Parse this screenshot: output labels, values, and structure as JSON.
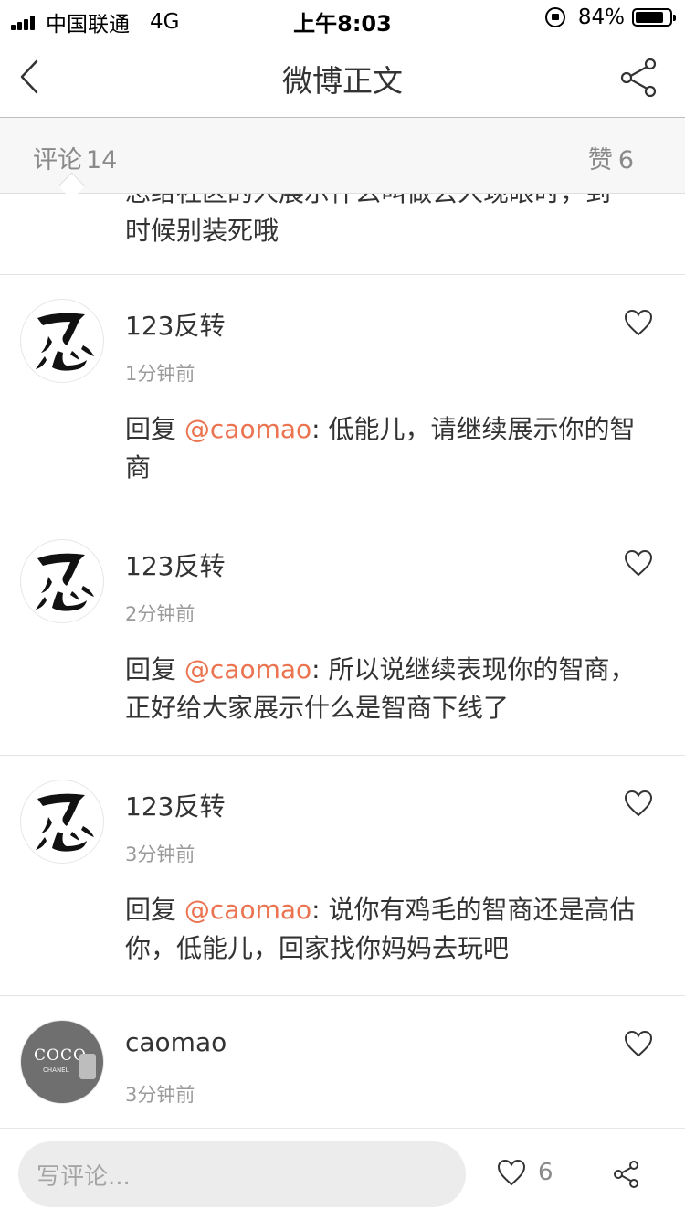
{
  "status_bar": {
    "carrier": "中国联通",
    "network": "4G",
    "time": "上午8:03",
    "battery_percent": "84%",
    "battery_level": 0.84
  },
  "nav": {
    "title": "微博正文",
    "back_icon": "chevron-left-icon",
    "share_icon": "share-icon"
  },
  "tabs": {
    "comments_label": "评论",
    "comments_count": "14",
    "likes_label": "赞",
    "likes_count": "6"
  },
  "partial_comment": {
    "text_line_cut": "忘给社区的人展示什么叫做丢人现眼时，到",
    "text_line": "时候别装死哦"
  },
  "comments": [
    {
      "user": "123反转",
      "time": "1分钟前",
      "prefix": "回复 ",
      "mention": "@caomao",
      "body": ": 低能儿，请继续展示你的智商"
    },
    {
      "user": "123反转",
      "time": "2分钟前",
      "prefix": "回复 ",
      "mention": "@caomao",
      "body": ": 所以说继续表现你的智商，正好给大家展示什么是智商下线了"
    },
    {
      "user": "123反转",
      "time": "3分钟前",
      "prefix": "回复 ",
      "mention": "@caomao",
      "body": ": 说你有鸡毛的智商还是高估你，低能儿，回家找你妈妈去玩吧"
    },
    {
      "user": "caomao",
      "time": "3分钟前",
      "avatar_text": "COCO",
      "avatar_sub": "CHANEL"
    }
  ],
  "bottom_bar": {
    "input_placeholder": "写评论...",
    "like_count": "6"
  },
  "colors": {
    "mention": "#eb7350",
    "secondary_text": "#9a9a9a",
    "tabs_background": "#f7f7f7"
  }
}
